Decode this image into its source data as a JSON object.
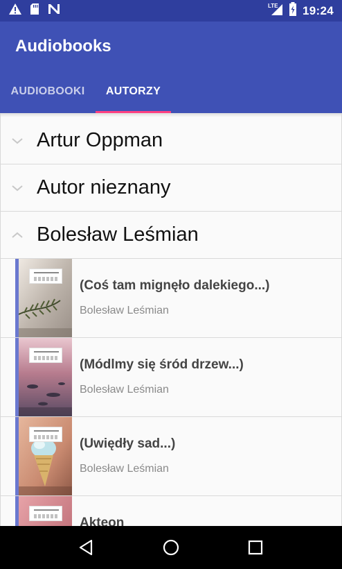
{
  "status_bar": {
    "time": "19:24",
    "network_label": "LTE",
    "icons": [
      "warning-icon",
      "sd-card-icon",
      "n-notification-icon",
      "signal-icon",
      "battery-icon"
    ]
  },
  "app_bar": {
    "title": "Audiobooks",
    "color": "#3f51b5",
    "status_color": "#2f3e9e",
    "indicator_color": "#ff4081"
  },
  "tabs": [
    {
      "label": "AUDIOBOOKI",
      "selected": false
    },
    {
      "label": "AUTORZY",
      "selected": true
    }
  ],
  "authors": [
    {
      "name": "Artur Oppman",
      "expanded": false,
      "icon": "chevron-down-icon"
    },
    {
      "name": "Autor nieznany",
      "expanded": false,
      "icon": "chevron-down-icon"
    },
    {
      "name": "Bolesław Leśmian",
      "expanded": true,
      "icon": "chevron-up-icon"
    }
  ],
  "books": [
    {
      "title": "(Coś tam mignęło dalekiego...)",
      "author": "Bolesław Leśmian"
    },
    {
      "title": "(Módlmy się śród drzew...)",
      "author": "Bolesław Leśmian"
    },
    {
      "title": "(Uwiędły sad...)",
      "author": "Bolesław Leśmian"
    },
    {
      "title": "Akteon",
      "author": ""
    }
  ],
  "nav_bar": {
    "icons": [
      "back-icon",
      "home-icon",
      "recents-icon"
    ]
  }
}
